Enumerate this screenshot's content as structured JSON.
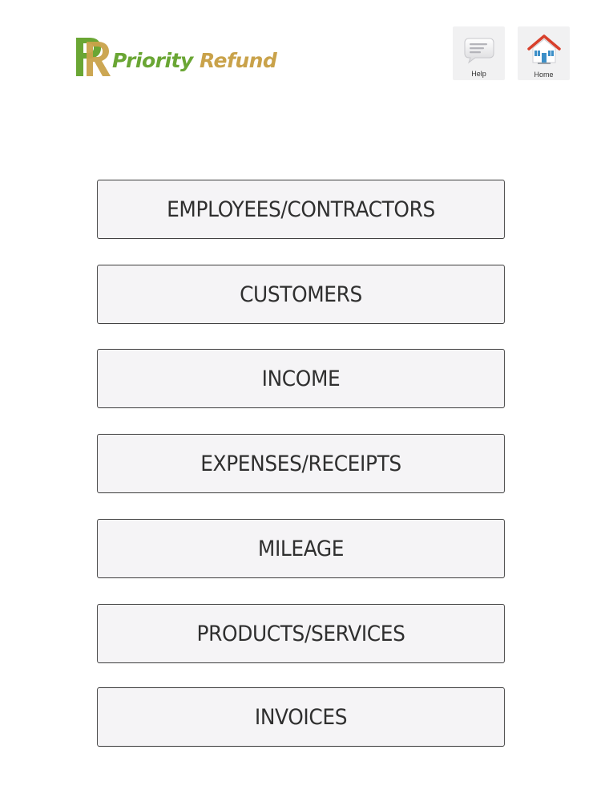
{
  "header": {
    "brand": {
      "word1": "Priority",
      "word2": "Refund",
      "green": "#6aa634",
      "gold": "#c9a24a"
    },
    "help": {
      "label": "Help",
      "icon": "chat-bubble-icon"
    },
    "home": {
      "label": "Home",
      "icon": "house-icon"
    }
  },
  "menu": {
    "items": [
      {
        "label": "EMPLOYEES/CONTRACTORS"
      },
      {
        "label": "CUSTOMERS"
      },
      {
        "label": "INCOME"
      },
      {
        "label": "EXPENSES/RECEIPTS"
      },
      {
        "label": "MILEAGE"
      },
      {
        "label": "PRODUCTS/SERVICES"
      },
      {
        "label": "INVOICES"
      }
    ]
  }
}
